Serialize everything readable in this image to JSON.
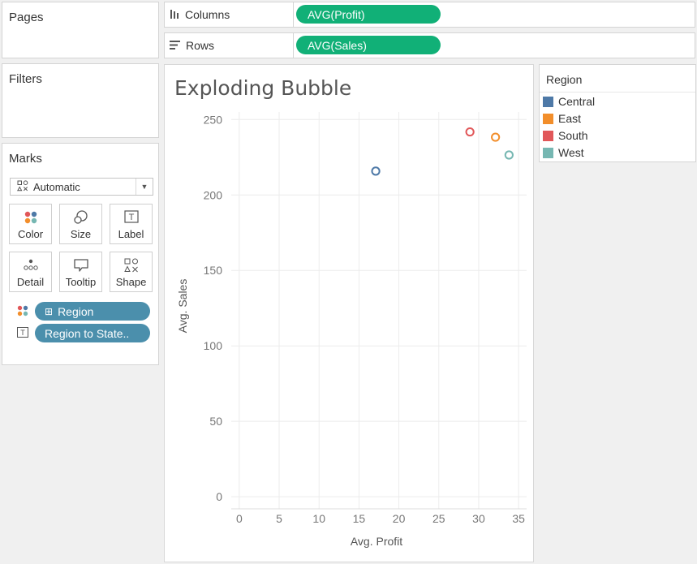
{
  "pages": {
    "title": "Pages"
  },
  "filters": {
    "title": "Filters"
  },
  "shelves": {
    "columns": {
      "label": "Columns",
      "pill": "AVG(Profit)"
    },
    "rows": {
      "label": "Rows",
      "pill": "AVG(Sales)"
    }
  },
  "marks": {
    "title": "Marks",
    "type": "Automatic",
    "buttons": [
      {
        "label": "Color",
        "icon": "color-dots-icon"
      },
      {
        "label": "Size",
        "icon": "size-circles-icon"
      },
      {
        "label": "Label",
        "icon": "label-text-icon"
      },
      {
        "label": "Detail",
        "icon": "detail-dots-icon"
      },
      {
        "label": "Tooltip",
        "icon": "tooltip-bubble-icon"
      },
      {
        "label": "Shape",
        "icon": "shape-icon"
      }
    ],
    "fields": [
      {
        "label": "Region",
        "icon": "color-dots-icon",
        "prefix": "⊞"
      },
      {
        "label": "Region to State..",
        "icon": "label-text-icon",
        "prefix": ""
      }
    ]
  },
  "legend": {
    "title": "Region",
    "items": [
      {
        "label": "Central",
        "color": "#4e79a7"
      },
      {
        "label": "East",
        "color": "#f28e2b"
      },
      {
        "label": "South",
        "color": "#e15759"
      },
      {
        "label": "West",
        "color": "#76b7b2"
      }
    ]
  },
  "chart_data": {
    "type": "scatter",
    "title": "Exploding Bubble",
    "xlabel": "Avg. Profit",
    "ylabel": "Avg. Sales",
    "xlim": [
      -1,
      36
    ],
    "ylim": [
      -8,
      255
    ],
    "xticks": [
      0,
      5,
      10,
      15,
      20,
      25,
      30,
      35
    ],
    "yticks": [
      0,
      50,
      100,
      150,
      200,
      250
    ],
    "grid": true,
    "series": [
      {
        "name": "Central",
        "color": "#4e79a7",
        "x": 17.1,
        "y": 215.8
      },
      {
        "name": "East",
        "color": "#f28e2b",
        "x": 32.1,
        "y": 238.3
      },
      {
        "name": "South",
        "color": "#e15759",
        "x": 28.9,
        "y": 241.8
      },
      {
        "name": "West",
        "color": "#76b7b2",
        "x": 33.8,
        "y": 226.5
      }
    ]
  }
}
